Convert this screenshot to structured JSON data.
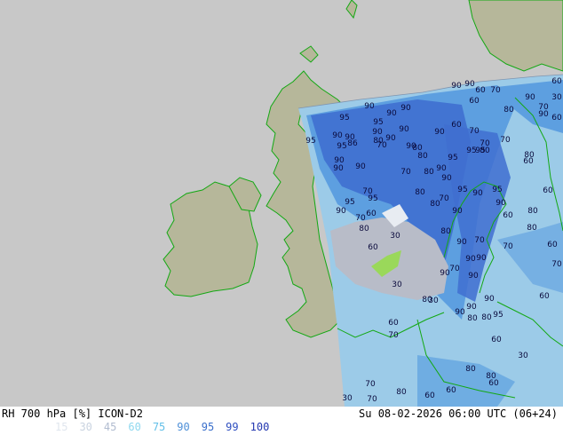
{
  "footer": {
    "title_left": "RH 700 hPa [%] ICON-D2",
    "title_right": "Su 08-02-2026 06:00 UTC (06+24)"
  },
  "legend": [
    {
      "label": "15",
      "color": "#e0e6ee"
    },
    {
      "label": "30",
      "color": "#c9d3e0"
    },
    {
      "label": "45",
      "color": "#b1bcd0"
    },
    {
      "label": "60",
      "color": "#8fd8ef"
    },
    {
      "label": "75",
      "color": "#62bfe8"
    },
    {
      "label": "90",
      "color": "#4f90d8"
    },
    {
      "label": "95",
      "color": "#3a6fcb"
    },
    {
      "label": "99",
      "color": "#2f4fc0"
    },
    {
      "label": "100",
      "color": "#2438b0"
    }
  ],
  "colors": {
    "sea_outside": "#c8c8c8",
    "land_outside": "#b6b79a",
    "coastline": "#13a813",
    "humid_low": "#9ccbe8",
    "humid_mid": "#5d9fe0",
    "humid_high": "#3f6fd0",
    "dry": "#b8bcc8",
    "very_dry": "#9ad85a"
  },
  "contour_labels": [
    {
      "text": "90"
    },
    {
      "text": "60"
    },
    {
      "text": "70"
    },
    {
      "text": "60"
    },
    {
      "text": "90"
    },
    {
      "text": "30"
    },
    {
      "text": "70"
    },
    {
      "text": "80"
    },
    {
      "text": "60"
    },
    {
      "text": "90"
    },
    {
      "text": "90"
    },
    {
      "text": "90"
    },
    {
      "text": "90"
    },
    {
      "text": "95"
    },
    {
      "text": "95"
    },
    {
      "text": "90"
    },
    {
      "text": "60"
    },
    {
      "text": "70"
    },
    {
      "text": "90"
    },
    {
      "text": "60"
    },
    {
      "text": "95"
    },
    {
      "text": "90"
    },
    {
      "text": "86"
    },
    {
      "text": "95"
    },
    {
      "text": "90"
    },
    {
      "text": "80"
    },
    {
      "text": "90"
    },
    {
      "text": "90"
    },
    {
      "text": "70"
    },
    {
      "text": "70"
    },
    {
      "text": "90"
    },
    {
      "text": "80"
    },
    {
      "text": "90"
    },
    {
      "text": "80"
    },
    {
      "text": "60"
    },
    {
      "text": "90"
    },
    {
      "text": "90"
    },
    {
      "text": "70"
    },
    {
      "text": "80"
    },
    {
      "text": "95"
    },
    {
      "text": "90"
    },
    {
      "text": "70"
    },
    {
      "text": "80"
    },
    {
      "text": "90"
    },
    {
      "text": "95"
    },
    {
      "text": "95"
    },
    {
      "text": "80"
    },
    {
      "text": "90"
    },
    {
      "text": "95"
    },
    {
      "text": "90"
    },
    {
      "text": "60"
    },
    {
      "text": "80"
    },
    {
      "text": "95"
    },
    {
      "text": "70"
    },
    {
      "text": "80"
    },
    {
      "text": "90"
    },
    {
      "text": "70"
    },
    {
      "text": "90"
    },
    {
      "text": "60"
    },
    {
      "text": "80"
    },
    {
      "text": "70"
    },
    {
      "text": "80"
    },
    {
      "text": "95"
    },
    {
      "text": "90"
    },
    {
      "text": "80"
    },
    {
      "text": "90"
    },
    {
      "text": "70"
    },
    {
      "text": "70"
    },
    {
      "text": "60"
    },
    {
      "text": "80"
    },
    {
      "text": "30"
    },
    {
      "text": "90"
    },
    {
      "text": "90"
    },
    {
      "text": "95"
    },
    {
      "text": "60"
    },
    {
      "text": "70"
    },
    {
      "text": "70"
    },
    {
      "text": "90"
    },
    {
      "text": "90"
    },
    {
      "text": "60"
    },
    {
      "text": "60"
    },
    {
      "text": "30"
    },
    {
      "text": "90"
    },
    {
      "text": "80"
    },
    {
      "text": "90"
    },
    {
      "text": "30"
    },
    {
      "text": "90"
    },
    {
      "text": "80"
    },
    {
      "text": "80"
    },
    {
      "text": "60"
    },
    {
      "text": "60"
    },
    {
      "text": "95"
    },
    {
      "text": "60"
    },
    {
      "text": "70"
    },
    {
      "text": "30"
    },
    {
      "text": "80"
    },
    {
      "text": "80"
    },
    {
      "text": "60"
    },
    {
      "text": "70"
    },
    {
      "text": "80"
    },
    {
      "text": "60"
    },
    {
      "text": "70"
    },
    {
      "text": "30"
    }
  ]
}
